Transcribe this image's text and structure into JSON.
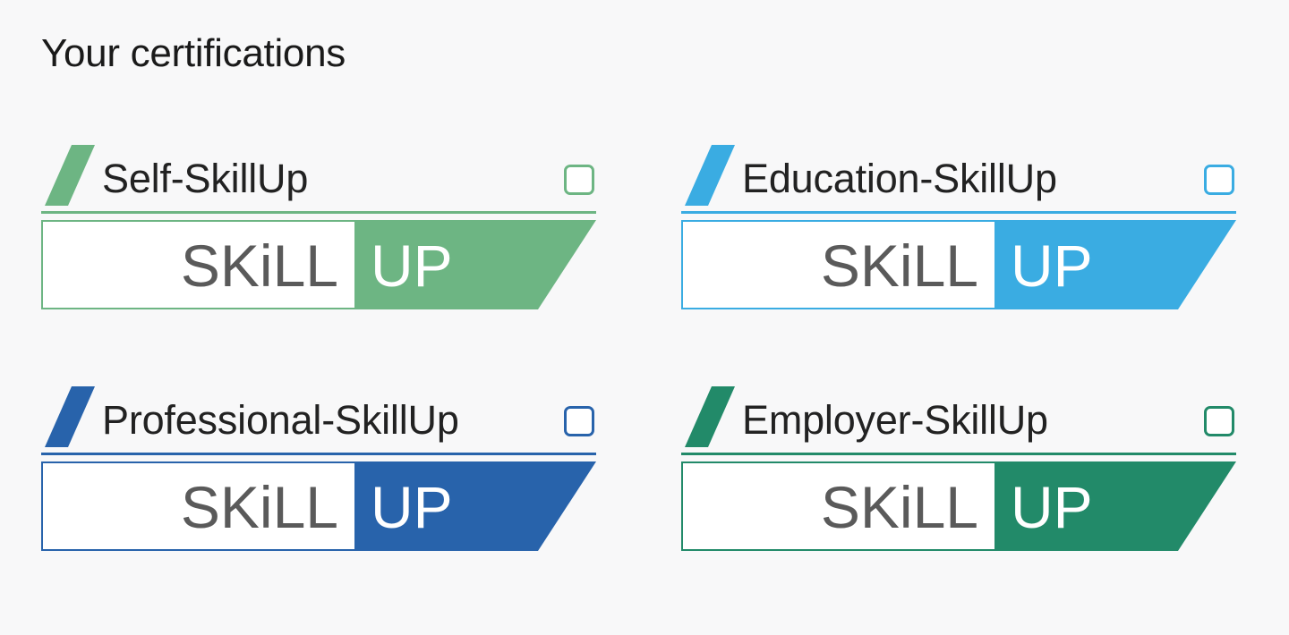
{
  "page": {
    "title": "Your certifications"
  },
  "badge": {
    "left_text": "SKiLL",
    "right_text": "UP",
    "left_text_color": "#5a5a5a",
    "right_text_color": "#ffffff"
  },
  "certifications": [
    {
      "name": "Self-SkillUp",
      "color": "#6db583",
      "checked": false
    },
    {
      "name": "Education-SkillUp",
      "color": "#3aace2",
      "checked": false
    },
    {
      "name": "Professional-SkillUp",
      "color": "#2863ab",
      "checked": false
    },
    {
      "name": "Employer-SkillUp",
      "color": "#228a69",
      "checked": false
    }
  ]
}
